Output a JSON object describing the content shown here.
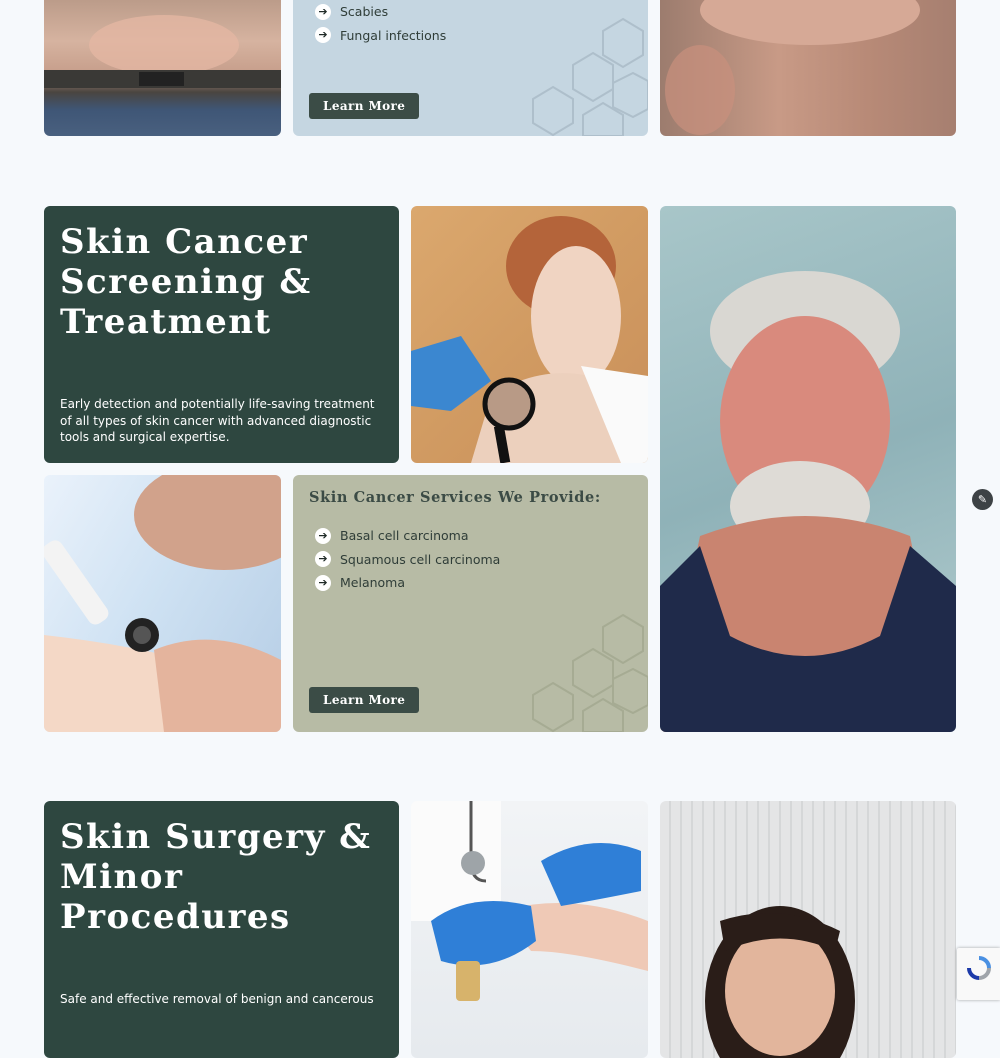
{
  "section_top": {
    "services": [
      "Scabies",
      "Fungal infections"
    ],
    "button_label": "Learn More"
  },
  "skin_cancer": {
    "title": "Skin Cancer Screening & Treatment",
    "description": "Early detection and potentially life-saving treatment of all types of skin cancer with advanced diagnostic tools and surgical expertise.",
    "services_heading": "Skin Cancer Services We Provide:",
    "services": [
      "Basal cell carcinoma",
      "Squamous cell carcinoma",
      "Melanoma"
    ],
    "button_label": "Learn More"
  },
  "skin_surgery": {
    "title": "Skin Surgery & Minor Procedures",
    "description": "Safe and effective removal of benign and cancerous"
  },
  "icons": {
    "list_bullet": "arrow-right-icon",
    "edit": "pencil-icon",
    "recaptcha": "recaptcha-icon"
  },
  "colors": {
    "dark_panel": "#2e4740",
    "blue_panel": "#c5d6e1",
    "sage_panel": "#b7bba5",
    "button": "#3b4c46",
    "page_bg": "#f6f9fc"
  }
}
